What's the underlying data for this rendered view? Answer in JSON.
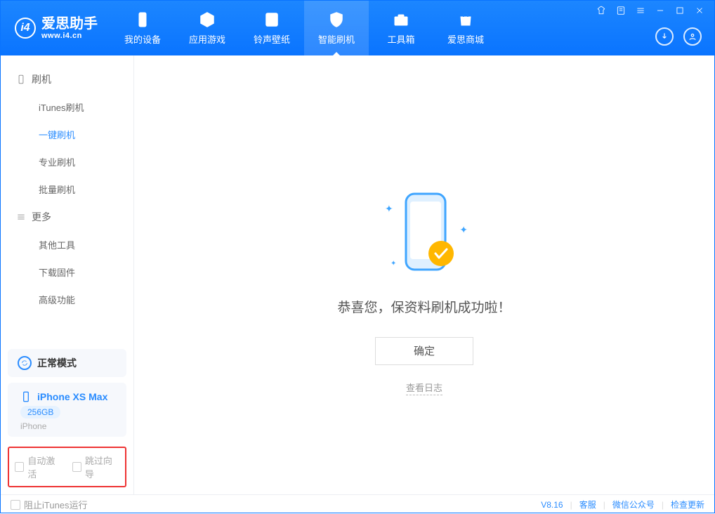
{
  "app": {
    "title": "爱思助手",
    "subtitle": "www.i4.cn"
  },
  "nav": [
    {
      "label": "我的设备"
    },
    {
      "label": "应用游戏"
    },
    {
      "label": "铃声壁纸"
    },
    {
      "label": "智能刷机"
    },
    {
      "label": "工具箱"
    },
    {
      "label": "爱思商城"
    }
  ],
  "sidebar": {
    "section_flash": "刷机",
    "items_flash": [
      {
        "label": "iTunes刷机"
      },
      {
        "label": "一键刷机"
      },
      {
        "label": "专业刷机"
      },
      {
        "label": "批量刷机"
      }
    ],
    "section_more": "更多",
    "items_more": [
      {
        "label": "其他工具"
      },
      {
        "label": "下载固件"
      },
      {
        "label": "高级功能"
      }
    ]
  },
  "device": {
    "mode": "正常模式",
    "name": "iPhone XS Max",
    "capacity": "256GB",
    "type": "iPhone"
  },
  "options": {
    "auto_activate": "自动激活",
    "skip_guide": "跳过向导"
  },
  "main": {
    "success_msg": "恭喜您，保资料刷机成功啦！",
    "confirm": "确定",
    "view_log": "查看日志"
  },
  "footer": {
    "block_itunes": "阻止iTunes运行",
    "version": "V8.16",
    "support": "客服",
    "wechat": "微信公众号",
    "check_update": "检查更新"
  }
}
